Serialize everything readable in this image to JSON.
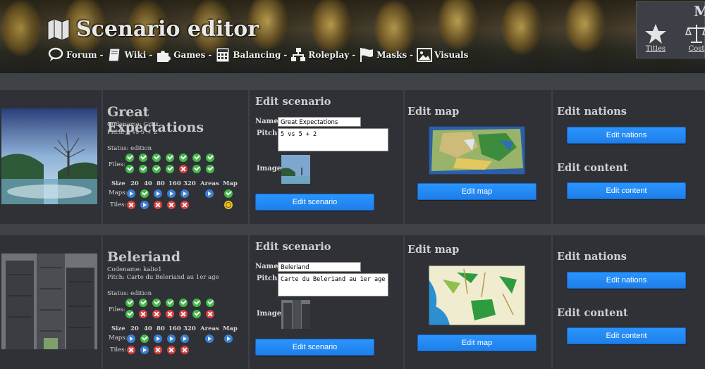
{
  "header": {
    "title": "Scenario editor",
    "nav": [
      {
        "label": "Forum",
        "icon": "speech-bubble-icon"
      },
      {
        "label": "Wiki",
        "icon": "book-icon"
      },
      {
        "label": "Games",
        "icon": "puzzle-icon"
      },
      {
        "label": "Balancing",
        "icon": "calculator-icon"
      },
      {
        "label": "Roleplay",
        "icon": "hierarchy-icon"
      },
      {
        "label": "Masks",
        "icon": "flag-icon"
      },
      {
        "label": "Visuals",
        "icon": "picture-icon"
      }
    ],
    "separator": "-",
    "side_letter": "M",
    "side_items": [
      {
        "label": "Titles",
        "icon": "star-icon"
      },
      {
        "label": "Cost",
        "icon": "scales-icon"
      }
    ]
  },
  "labels": {
    "codename_prefix": "Codename: ",
    "pitch_prefix": "Pitch: ",
    "status_prefix": "Status: ",
    "files": "Files:",
    "size": "Size",
    "sizes": [
      "20",
      "40",
      "80",
      "160",
      "320"
    ],
    "areas": "Areas",
    "map": "Map",
    "maps": "Maps:",
    "tiles": "Tiles:",
    "edit_scenario_title": "Edit scenario",
    "name": "Name:",
    "pitch": "Pitch:",
    "image": "Image",
    "edit_scenario_btn": "Edit scenario",
    "edit_map_title": "Edit map",
    "edit_map_btn": "Edit map",
    "edit_nations_title": "Edit nations",
    "edit_nations_btn": "Edit nations",
    "edit_content_title": "Edit content",
    "edit_content_btn": "Edit content"
  },
  "scenarios": [
    {
      "name": "Great Expectations",
      "codename": "GrEx",
      "pitch": "5 vs 5 + 2",
      "status": "edition",
      "files": [
        "ok",
        "ok",
        "ok",
        "ok",
        "ok",
        "ok",
        "ok",
        "ok",
        "ok",
        "ok",
        "ok",
        "no",
        "ok",
        "ok"
      ],
      "maps": [
        "play",
        "ok",
        "play",
        "play",
        "play",
        "play",
        "ok"
      ],
      "tiles": [
        "no",
        "play",
        "no",
        "no",
        "no",
        "target"
      ]
    },
    {
      "name": "Beleriand",
      "codename": "kalio1",
      "pitch": "Carte du Beleriand au 1er age",
      "status": "edition",
      "files": [
        "ok",
        "ok",
        "ok",
        "ok",
        "ok",
        "ok",
        "ok",
        "ok",
        "no",
        "no",
        "no",
        "no",
        "ok",
        "no"
      ],
      "maps": [
        "play",
        "ok",
        "play",
        "play",
        "play",
        "play",
        "play"
      ],
      "tiles": [
        "no",
        "play",
        "no",
        "no",
        "no"
      ]
    }
  ]
}
